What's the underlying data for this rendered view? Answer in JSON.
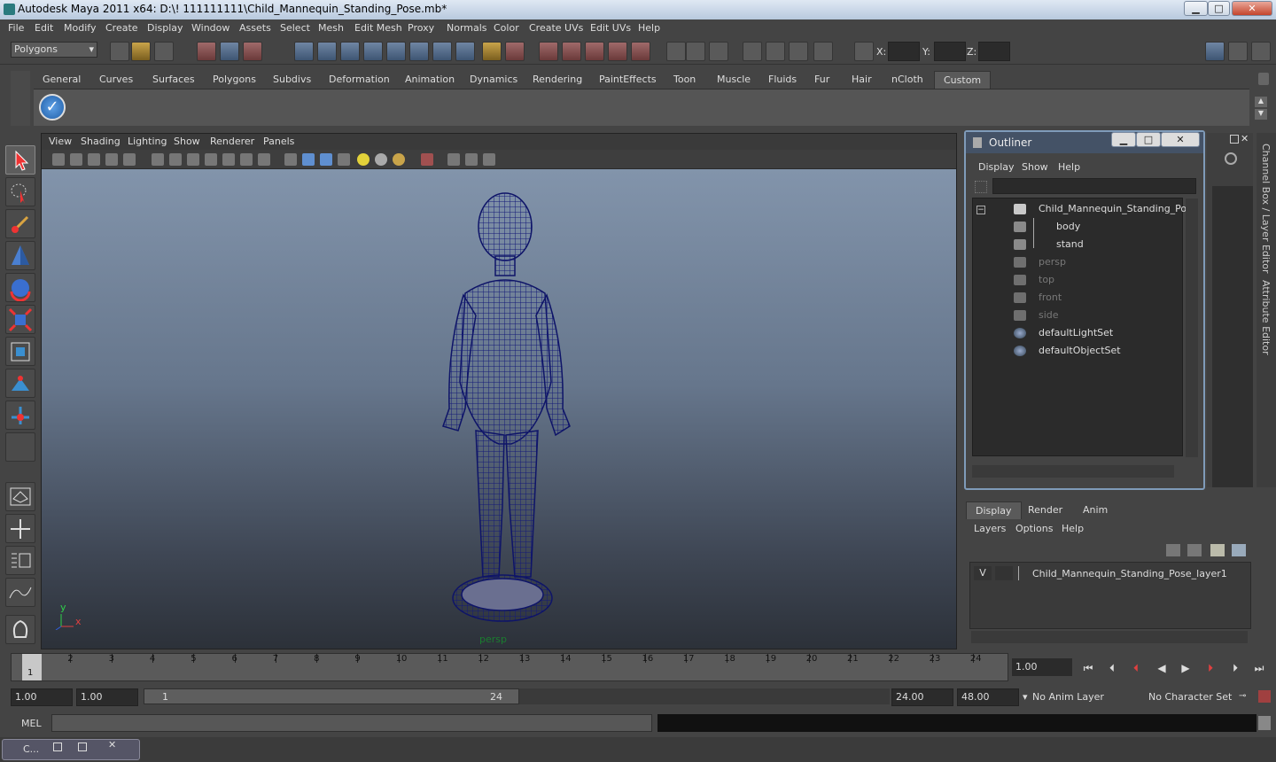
{
  "window": {
    "title": "Autodesk Maya 2011 x64: D:\\! 111111111\\Child_Mannequin_Standing_Pose.mb*",
    "min": "▁",
    "max": "□",
    "close": "✕"
  },
  "menubar": [
    "File",
    "Edit",
    "Modify",
    "Create",
    "Display",
    "Window",
    "Assets",
    "Select",
    "Mesh",
    "Edit Mesh",
    "Proxy",
    "Normals",
    "Color",
    "Create UVs",
    "Edit UVs",
    "Help"
  ],
  "statusline": {
    "mode": "Polygons",
    "x_label": "X:",
    "y_label": "Y:",
    "z_label": "Z:"
  },
  "shelf_tabs": [
    "General",
    "Curves",
    "Surfaces",
    "Polygons",
    "Subdivs",
    "Deformation",
    "Animation",
    "Dynamics",
    "Rendering",
    "PaintEffects",
    "Toon",
    "Muscle",
    "Fluids",
    "Fur",
    "Hair",
    "nCloth",
    "Custom"
  ],
  "shelf_active": "Custom",
  "viewport": {
    "menu": [
      "View",
      "Shading",
      "Lighting",
      "Show",
      "Renderer",
      "Panels"
    ],
    "camera": "persp",
    "axis_y": "y",
    "axis_x": "x"
  },
  "outliner": {
    "title": "Outliner",
    "menu": [
      "Display",
      "Show",
      "Help"
    ],
    "items": [
      {
        "label": "Child_Mannequin_Standing_Pose",
        "dim": false
      },
      {
        "label": "body",
        "dim": false
      },
      {
        "label": "stand",
        "dim": false
      },
      {
        "label": "persp",
        "dim": true
      },
      {
        "label": "top",
        "dim": true
      },
      {
        "label": "front",
        "dim": true
      },
      {
        "label": "side",
        "dim": true
      },
      {
        "label": "defaultLightSet",
        "dim": false
      },
      {
        "label": "defaultObjectSet",
        "dim": false
      }
    ]
  },
  "side_tabs": {
    "channel_box": "Channel Box / Layer Editor",
    "attribute_editor": "Attribute Editor"
  },
  "layer_editor": {
    "tabs": [
      "Display",
      "Render",
      "Anim"
    ],
    "menu": [
      "Layers",
      "Options",
      "Help"
    ],
    "layer": {
      "visible": "V",
      "name": "Child_Mannequin_Standing_Pose_layer1"
    }
  },
  "timeline": {
    "ticks": [
      "1",
      "2",
      "3",
      "4",
      "5",
      "6",
      "7",
      "8",
      "9",
      "10",
      "11",
      "12",
      "13",
      "14",
      "15",
      "16",
      "17",
      "18",
      "19",
      "20",
      "21",
      "22",
      "23",
      "24"
    ],
    "current_marker": "1",
    "current_frame": "1.00"
  },
  "range": {
    "start": "1.00",
    "start_inner": "1.00",
    "bar_start": "1",
    "bar_end": "24",
    "end_inner": "24.00",
    "end": "48.00",
    "anim_layer": "No Anim Layer",
    "character_set": "No Character Set"
  },
  "cmdline": {
    "label": "MEL"
  },
  "taskbar": {
    "label": "C..."
  }
}
